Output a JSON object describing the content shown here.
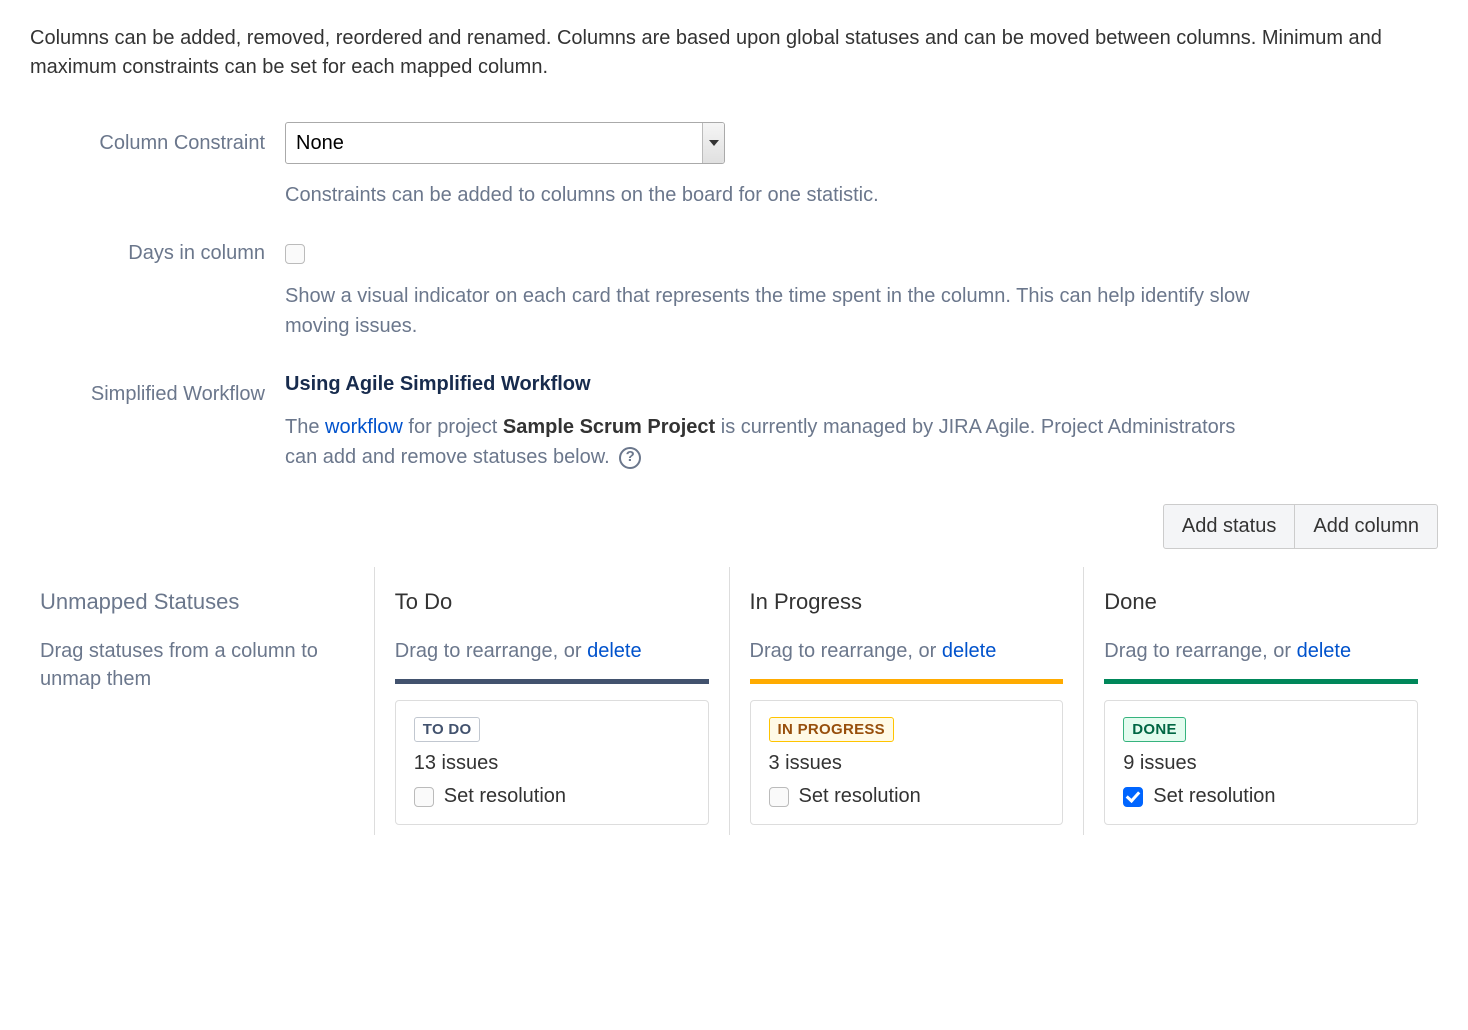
{
  "intro": "Columns can be added, removed, reordered and renamed. Columns are based upon global statuses and can be moved between columns. Minimum and maximum constraints can be set for each mapped column.",
  "constraint": {
    "label": "Column Constraint",
    "value": "None",
    "helper": "Constraints can be added to columns on the board for one statistic."
  },
  "days": {
    "label": "Days in column",
    "checked": false,
    "helper": "Show a visual indicator on each card that represents the time spent in the column. This can help identify slow moving issues."
  },
  "workflow": {
    "label": "Simplified Workflow",
    "title": "Using Agile Simplified Workflow",
    "desc_pre": "The ",
    "desc_link": "workflow",
    "desc_mid": " for project ",
    "desc_project": "Sample Scrum Project",
    "desc_post": " is currently managed by JIRA Agile. Project Administrators can add and remove statuses below. ",
    "help_char": "?"
  },
  "actions": {
    "add_status": "Add status",
    "add_column": "Add column"
  },
  "unmapped": {
    "title": "Unmapped Statuses",
    "sub": "Drag statuses from a column to unmap them"
  },
  "columns": [
    {
      "title": "To Do",
      "sub_pre": "Drag to rearrange, or ",
      "sub_link": "delete",
      "bar": "bar-blue",
      "status": {
        "text": "TO DO",
        "class": "loz-todo"
      },
      "issues": "13 issues",
      "resolution_label": "Set resolution",
      "resolution_checked": false
    },
    {
      "title": "In Progress",
      "sub_pre": "Drag to rearrange, or ",
      "sub_link": "delete",
      "bar": "bar-yellow",
      "status": {
        "text": "IN PROGRESS",
        "class": "loz-inprogress"
      },
      "issues": "3 issues",
      "resolution_label": "Set resolution",
      "resolution_checked": false
    },
    {
      "title": "Done",
      "sub_pre": "Drag to rearrange, or ",
      "sub_link": "delete",
      "bar": "bar-green",
      "status": {
        "text": "DONE",
        "class": "loz-done"
      },
      "issues": "9 issues",
      "resolution_label": "Set resolution",
      "resolution_checked": true
    }
  ]
}
